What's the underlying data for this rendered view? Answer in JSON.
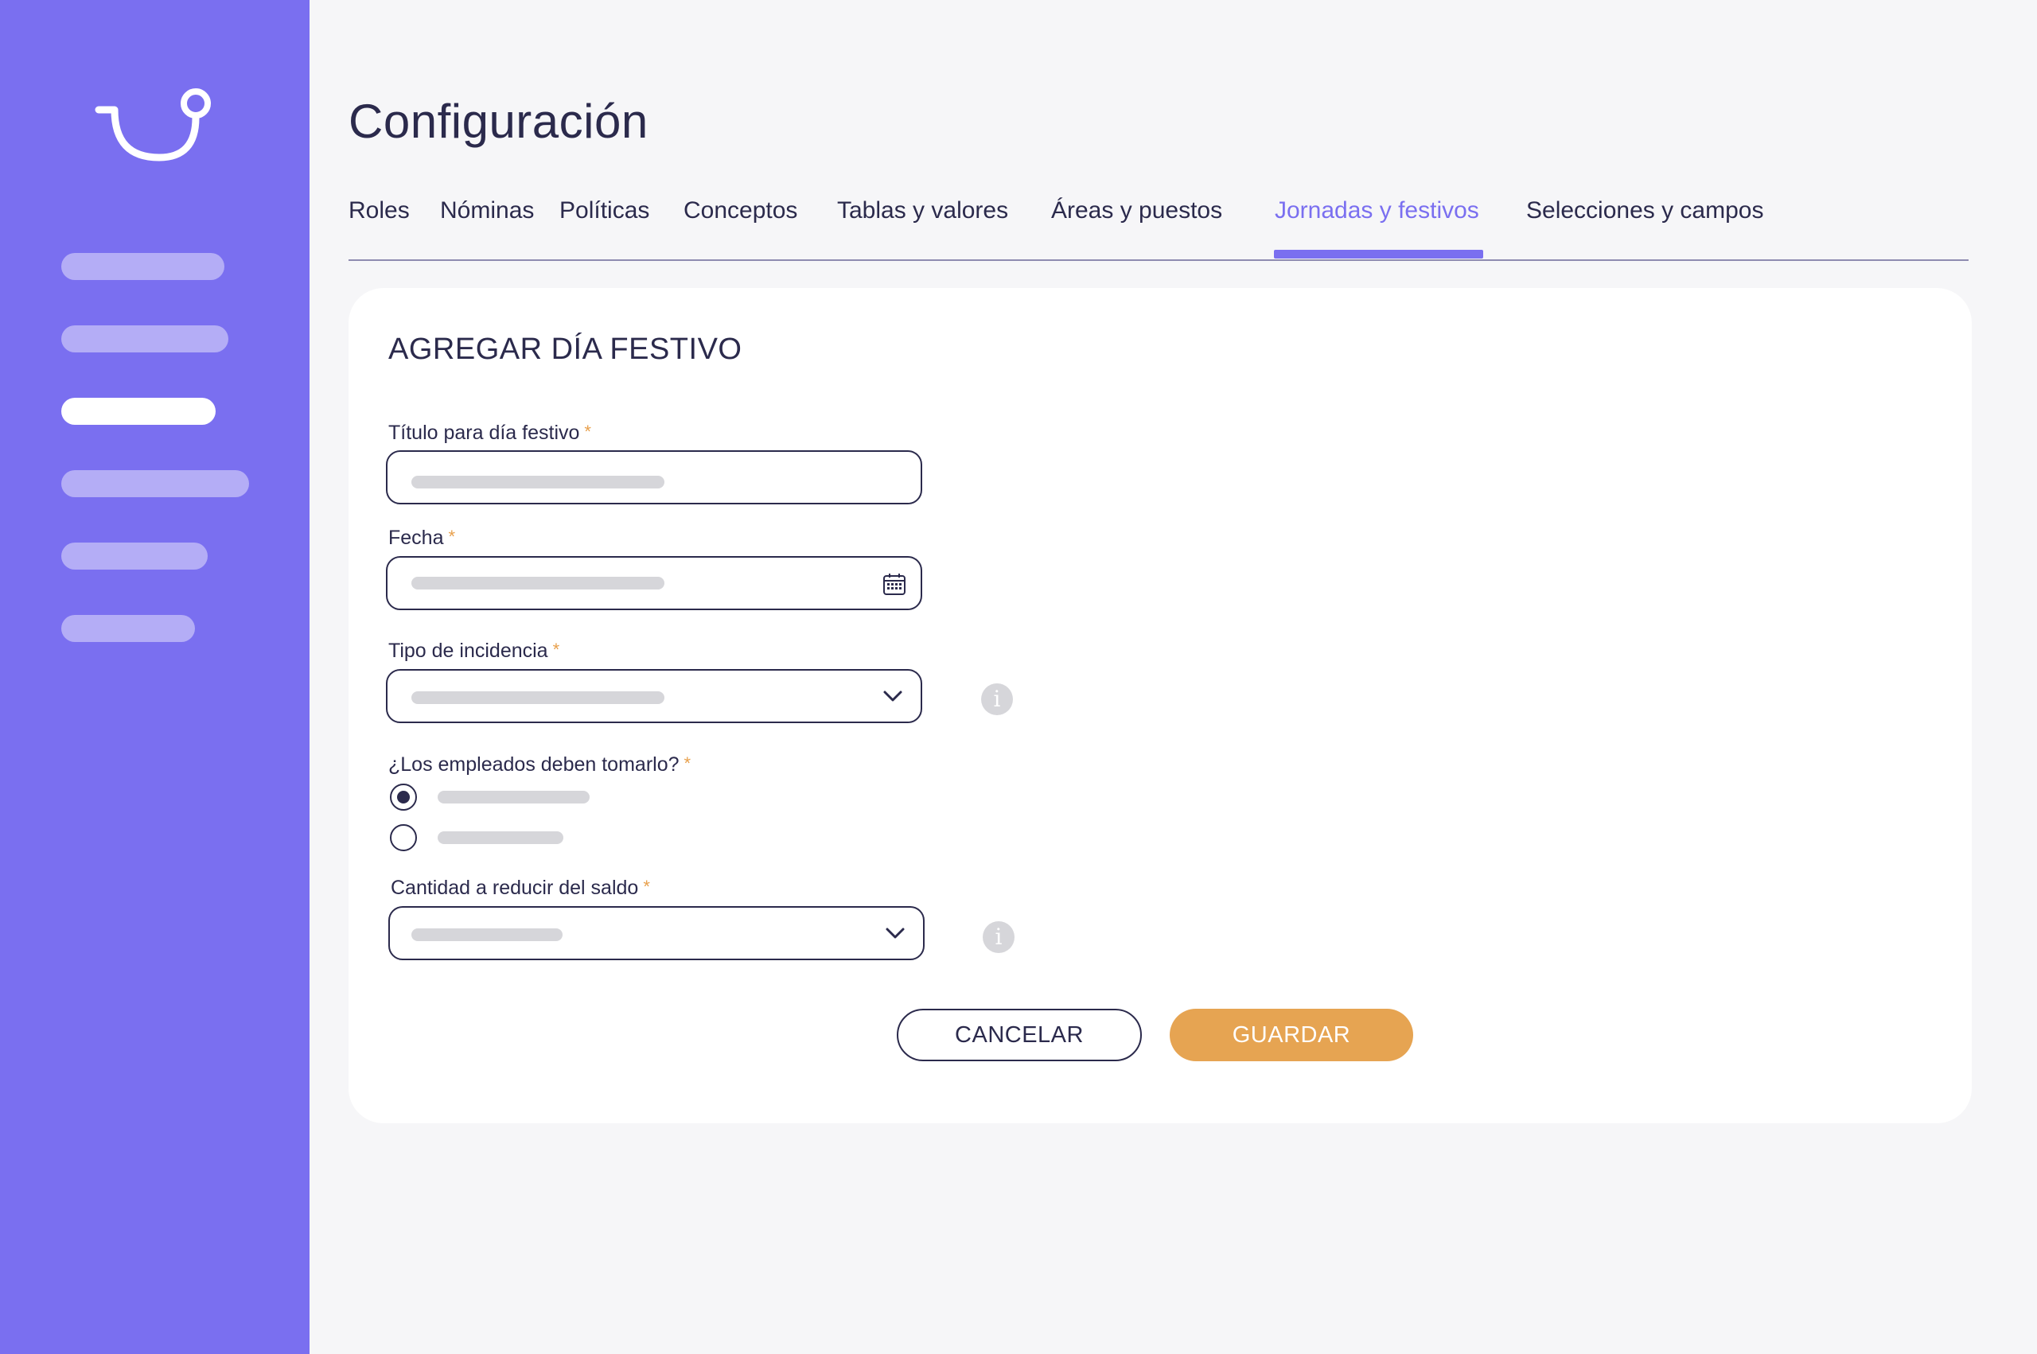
{
  "app": {
    "title": "Configuración",
    "accent_color": "#7a6ff0",
    "primary_button_color": "#e6a452"
  },
  "sidebar": {
    "logo_icon": "smile-logo-icon",
    "items": [
      {
        "state": "inactive"
      },
      {
        "state": "inactive"
      },
      {
        "state": "active"
      },
      {
        "state": "inactive"
      },
      {
        "state": "inactive"
      },
      {
        "state": "inactive"
      }
    ]
  },
  "tabs": [
    {
      "label": "Roles",
      "active": false
    },
    {
      "label": "Nóminas",
      "active": false
    },
    {
      "label": "Políticas",
      "active": false
    },
    {
      "label": "Conceptos",
      "active": false
    },
    {
      "label": "Tablas y valores",
      "active": false
    },
    {
      "label": "Áreas y puestos",
      "active": false
    },
    {
      "label": "Jornadas y festivos",
      "active": true
    },
    {
      "label": "Selecciones y campos",
      "active": false
    }
  ],
  "form": {
    "title": "AGREGAR DÍA FESTIVO",
    "required_mark": "*",
    "holiday_title": {
      "label": "Título para día festivo"
    },
    "date": {
      "label": "Fecha",
      "icon": "calendar-icon"
    },
    "incidence_type": {
      "label": "Tipo de incidencia",
      "icon": "chevron-down-icon",
      "info_icon": "info-icon",
      "info_glyph": "i"
    },
    "employees_take": {
      "label": "¿Los empleados deben tomarlo?",
      "options": [
        {
          "selected": true
        },
        {
          "selected": false
        }
      ]
    },
    "reduce_amount": {
      "label": "Cantidad a reducir del saldo",
      "icon": "chevron-down-icon",
      "info_icon": "info-icon",
      "info_glyph": "i"
    }
  },
  "actions": {
    "cancel_label": "CANCELAR",
    "save_label": "GUARDAR"
  }
}
